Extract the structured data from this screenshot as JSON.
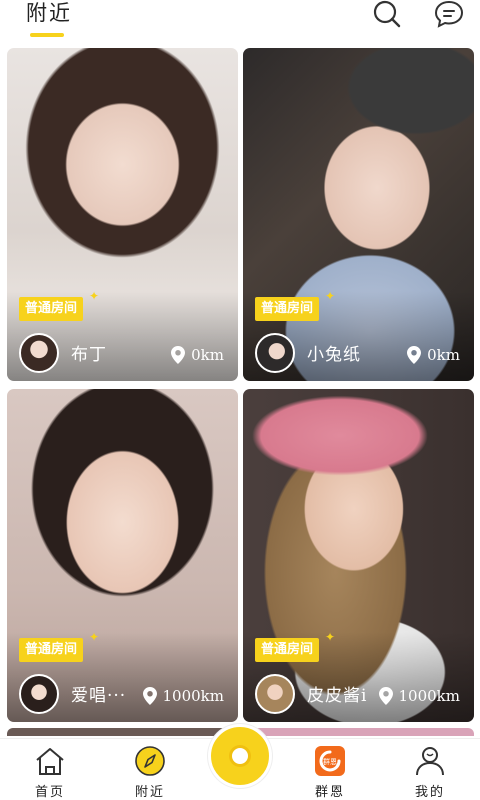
{
  "header": {
    "tab_label": "附近",
    "search_icon": "search-icon",
    "message_icon": "message-icon"
  },
  "accent_color": "#f7d21c",
  "cards": [
    {
      "tag": "普通房间",
      "nickname": "布丁",
      "distance": "0km",
      "photo_colors": [
        "#e9e4e1",
        "#b9a79b",
        "#6b4b3e"
      ]
    },
    {
      "tag": "普通房间",
      "nickname": "小兔纸",
      "distance": "0km",
      "photo_colors": [
        "#2d2a2a",
        "#8a7f76",
        "#b7c3d8"
      ]
    },
    {
      "tag": "普通房间",
      "nickname": "爱唱···",
      "distance": "1000km",
      "photo_colors": [
        "#d9c8c2",
        "#a98c86",
        "#4a3a37"
      ]
    },
    {
      "tag": "普通房间",
      "nickname": "皮皮酱i",
      "distance": "1000km",
      "photo_colors": [
        "#4b3f3d",
        "#a6855c",
        "#e08a9c"
      ]
    }
  ],
  "nav": {
    "items": [
      {
        "label": "首页",
        "icon": "home-icon"
      },
      {
        "label": "附近",
        "icon": "compass-icon"
      },
      {
        "label": "群恩",
        "icon": "group-chat-icon"
      },
      {
        "label": "我的",
        "icon": "profile-icon"
      }
    ],
    "center_button_icon": "live-record-icon"
  }
}
